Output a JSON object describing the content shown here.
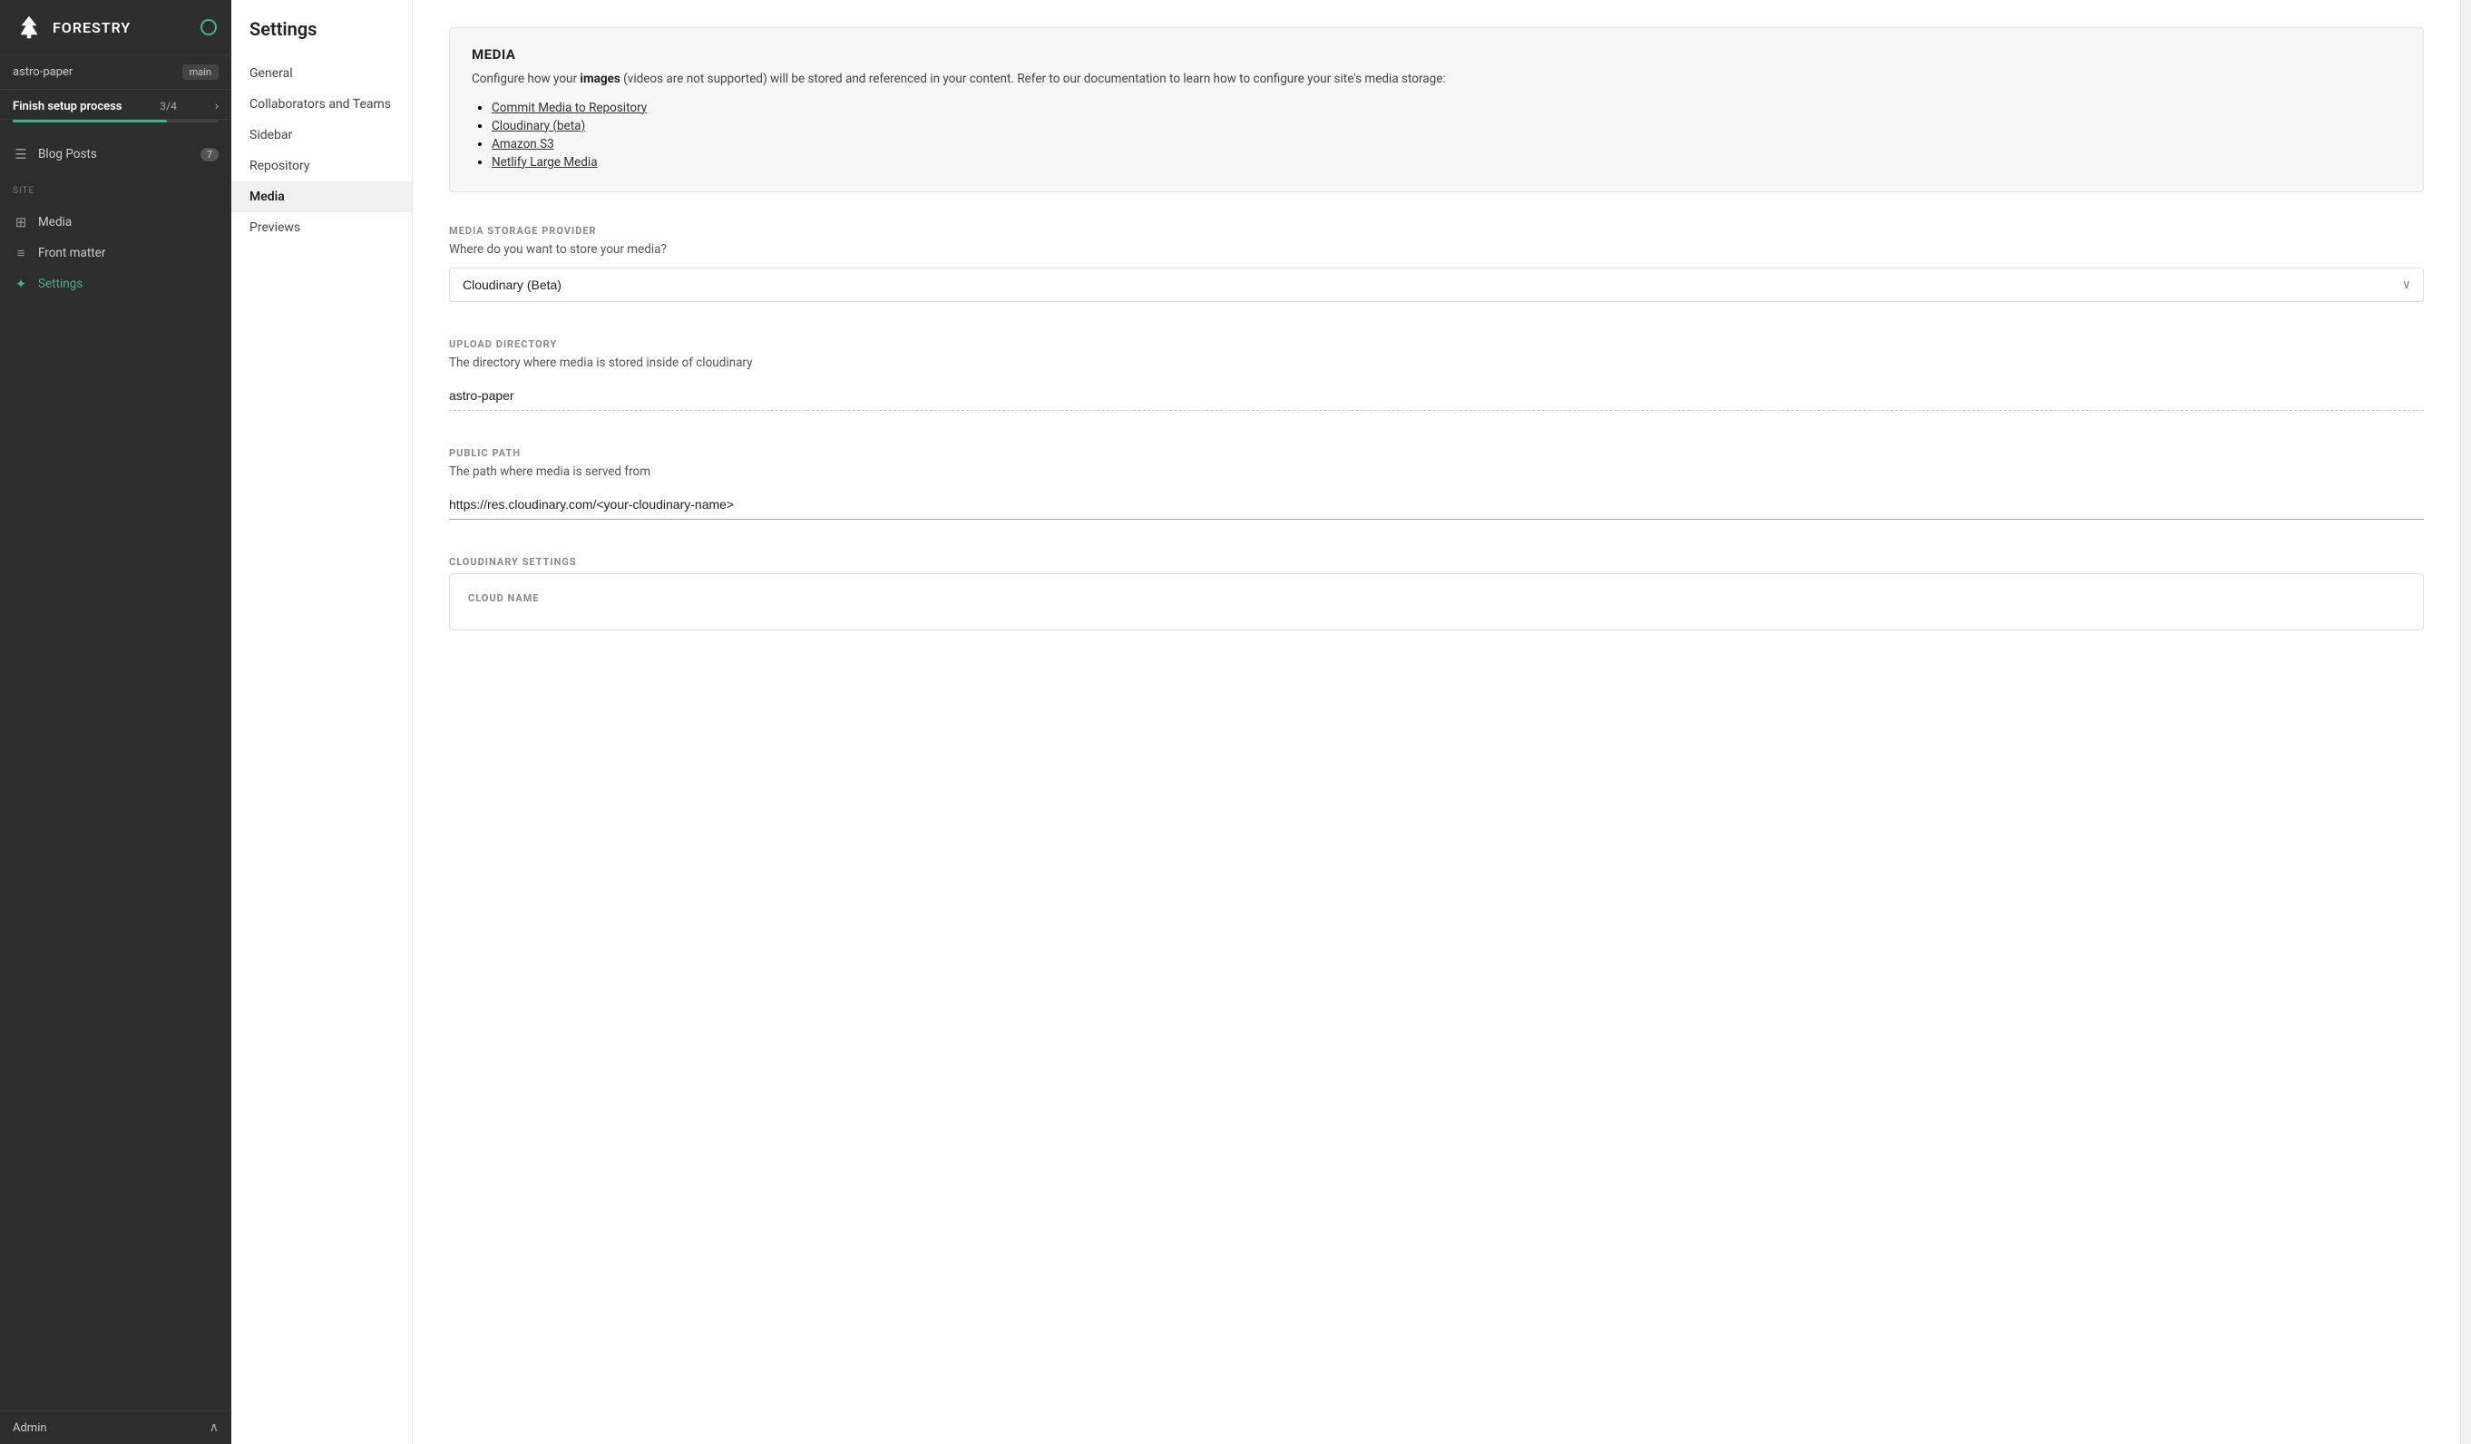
{
  "sidebar": {
    "logo_text": "FORESTRY",
    "repo_name": "astro-paper",
    "branch": "main",
    "setup": {
      "title": "Finish setup process",
      "count": "3/4",
      "progress_pct": 75
    },
    "content_section_label": "",
    "blog_posts_label": "Blog Posts",
    "blog_posts_count": "7",
    "site_section_label": "SITE",
    "media_label": "Media",
    "front_matter_label": "Front matter",
    "settings_label": "Settings",
    "admin_label": "Admin"
  },
  "settings_nav": {
    "title": "Settings",
    "items": [
      {
        "id": "general",
        "label": "General"
      },
      {
        "id": "collaborators",
        "label": "Collaborators and Teams"
      },
      {
        "id": "sidebar",
        "label": "Sidebar"
      },
      {
        "id": "repository",
        "label": "Repository"
      },
      {
        "id": "media",
        "label": "Media"
      },
      {
        "id": "previews",
        "label": "Previews"
      }
    ]
  },
  "media_section": {
    "info_box": {
      "title": "MEDIA",
      "description_part1": "Configure how your ",
      "description_bold": "images",
      "description_part2": " (videos are not supported) will be stored and referenced in your content. Refer to our documentation to learn how to configure your site's media storage:",
      "links": [
        "Commit Media to Repository",
        "Cloudinary (beta)",
        "Amazon S3",
        "Netlify Large Media"
      ]
    },
    "storage_provider": {
      "label": "MEDIA STORAGE PROVIDER",
      "description": "Where do you want to store your media?",
      "selected": "Cloudinary (Beta)",
      "options": [
        "Commit Media to Repository",
        "Cloudinary (Beta)",
        "Amazon S3",
        "Netlify Large Media"
      ]
    },
    "upload_directory": {
      "label": "UPLOAD DIRECTORY",
      "description": "The directory where media is stored inside of cloudinary",
      "value": "astro-paper"
    },
    "public_path": {
      "label": "PUBLIC PATH",
      "description": "The path where media is served from",
      "value": "https://res.cloudinary.com/<your-cloudinary-name>"
    },
    "cloudinary_settings": {
      "label": "CLOUDINARY SETTINGS",
      "cloud_name_label": "CLOUD NAME"
    }
  }
}
